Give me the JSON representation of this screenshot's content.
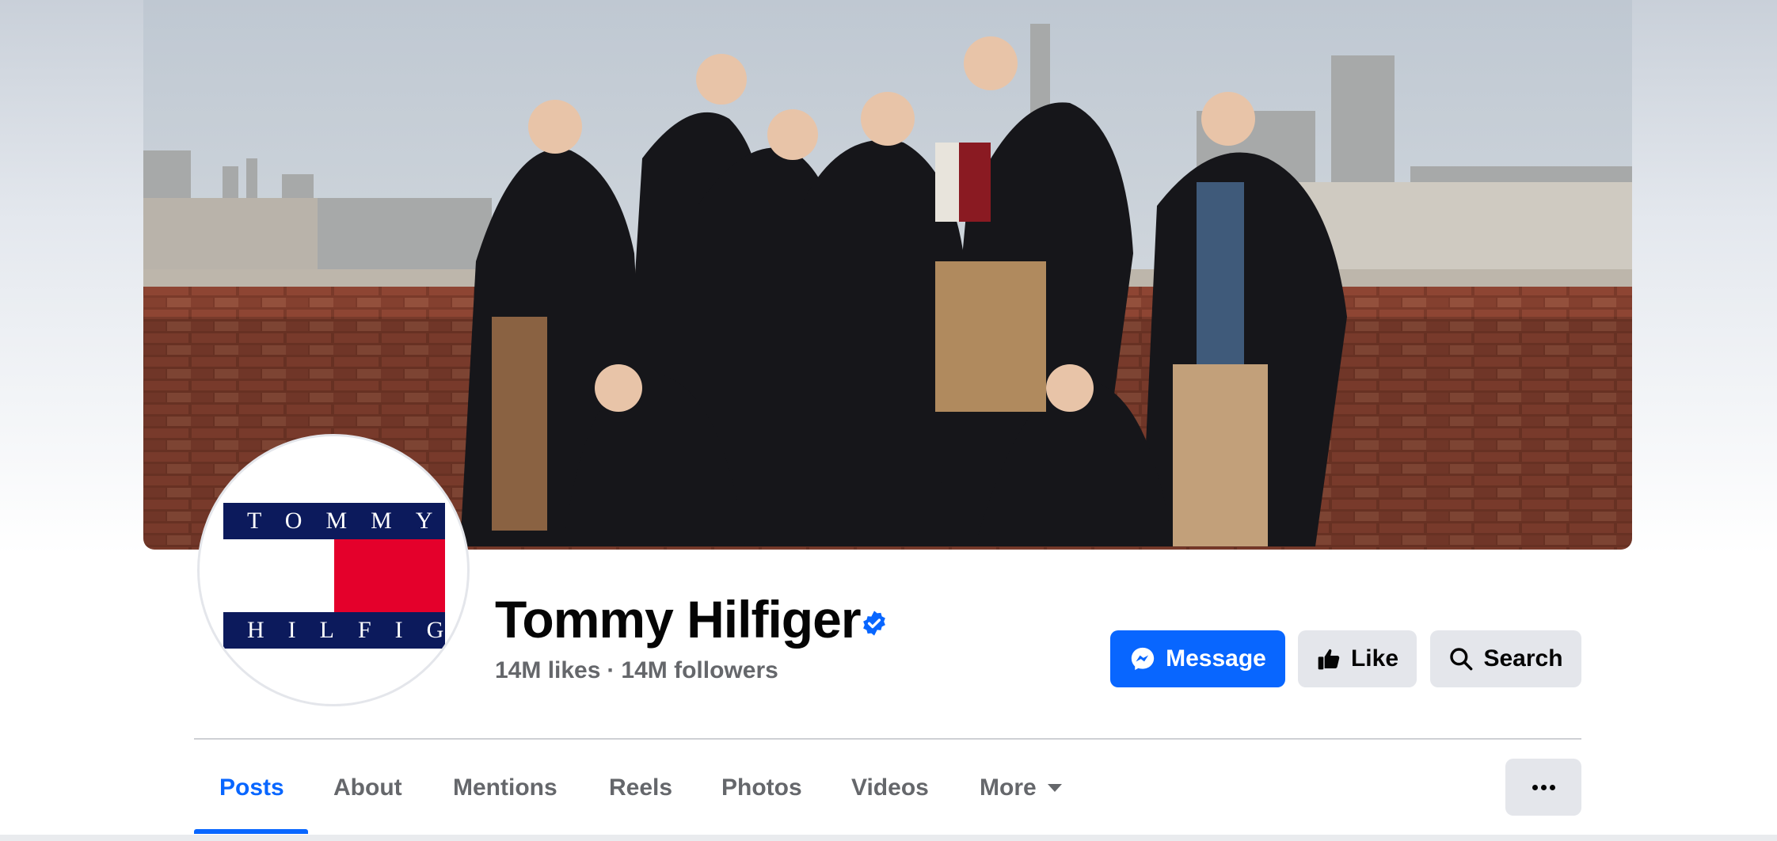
{
  "page": {
    "name": "Tommy Hilfiger",
    "likes": "14M likes",
    "separator": "·",
    "followers": "14M followers"
  },
  "logo": {
    "top_text": "TOMMY",
    "bottom_text": "HILFIGER"
  },
  "actions": {
    "message_label": "Message",
    "like_label": "Like",
    "search_label": "Search"
  },
  "tabs": [
    {
      "label": "Posts",
      "active": true
    },
    {
      "label": "About"
    },
    {
      "label": "Mentions"
    },
    {
      "label": "Reels"
    },
    {
      "label": "Photos"
    },
    {
      "label": "Videos"
    },
    {
      "label": "More"
    }
  ],
  "icons": {
    "verified": "verified-badge-icon",
    "message": "messenger-icon",
    "like": "thumbs-up-icon",
    "search": "search-icon",
    "more_caret": "caret-down-icon",
    "overflow": "more-horizontal-icon"
  },
  "colors": {
    "accent": "#0866ff",
    "button_gray": "#e4e6eb",
    "text_secondary": "#65676b",
    "logo_navy": "#0c1a5c",
    "logo_red": "#e4002b"
  }
}
